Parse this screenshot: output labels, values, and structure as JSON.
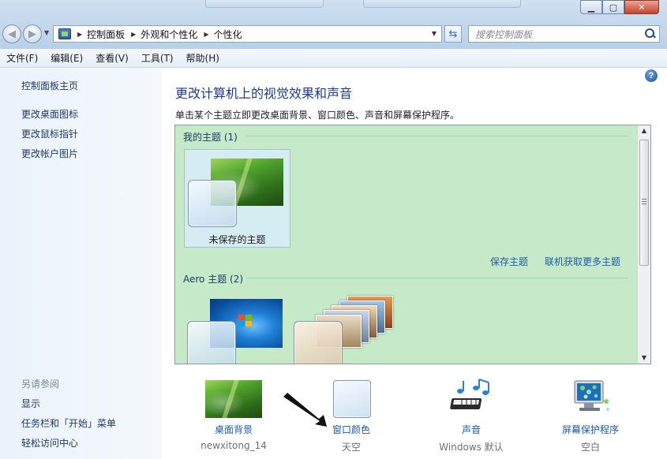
{
  "window": {
    "address_crumbs": [
      "控制面板",
      "外观和个性化",
      "个性化"
    ],
    "search_placeholder": "搜索控制面板",
    "buttons": {
      "minimize": "▁",
      "maximize": "▢",
      "close": "✕"
    }
  },
  "menubar": [
    "文件(F)",
    "编辑(E)",
    "查看(V)",
    "工具(T)",
    "帮助(H)"
  ],
  "leftpane": {
    "links": [
      "控制面板主页",
      "更改桌面图标",
      "更改鼠标指针",
      "更改帐户图片"
    ],
    "see_also_heading": "另请参阅",
    "see_also_links": [
      "显示",
      "任务栏和「开始」菜单",
      "轻松访问中心"
    ]
  },
  "main": {
    "title": "更改计算机上的视觉效果和声音",
    "subtitle": "单击某个主题立即更改桌面背景、窗口颜色、声音和屏幕保护程序。",
    "my_themes_label": "我的主题 (1)",
    "unsaved_theme": "未保存的主题",
    "save_theme": "保存主题",
    "get_more_themes": "联机获取更多主题",
    "aero_label": "Aero 主题 (2)"
  },
  "shortcuts": [
    {
      "label": "桌面背景",
      "value": "newxitong_14",
      "icon": "desktop-background-icon"
    },
    {
      "label": "窗口颜色",
      "value": "天空",
      "icon": "window-color-icon"
    },
    {
      "label": "声音",
      "value": "Windows 默认",
      "icon": "sound-icon"
    },
    {
      "label": "屏幕保护程序",
      "value": "空白",
      "icon": "screensaver-icon"
    }
  ],
  "colors": {
    "accent_link": "#1e5bb0",
    "title_blue": "#1e3c8f",
    "theme_panel_bg": "#c6e9c8"
  }
}
